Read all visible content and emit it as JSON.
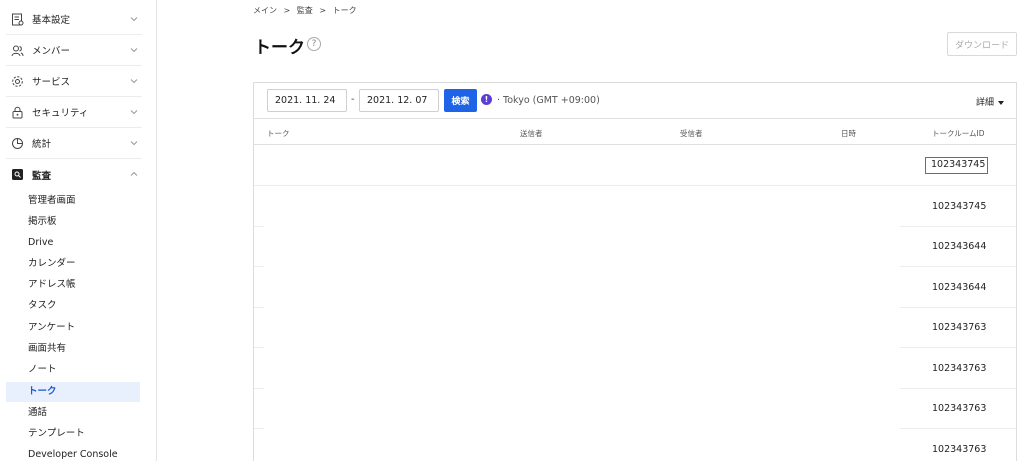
{
  "sidebar": {
    "groups": [
      {
        "label": "基本設定",
        "icon": "settings-doc-icon",
        "expanded": false
      },
      {
        "label": "メンバー",
        "icon": "users-icon",
        "expanded": false
      },
      {
        "label": "サービス",
        "icon": "gear-icon",
        "expanded": false
      },
      {
        "label": "セキュリティ",
        "icon": "lock-icon",
        "expanded": false
      },
      {
        "label": "統計",
        "icon": "pie-chart-icon",
        "expanded": false
      },
      {
        "label": "監査",
        "icon": "audit-icon",
        "expanded": true
      }
    ],
    "audit_items": [
      "管理者画面",
      "掲示板",
      "Drive",
      "カレンダー",
      "アドレス帳",
      "タスク",
      "アンケート",
      "画面共有",
      "ノート",
      "トーク",
      "通話",
      "テンプレート",
      "Developer Console"
    ],
    "active_item": "トーク"
  },
  "breadcrumb": [
    "メイン",
    "監査",
    "トーク"
  ],
  "breadcrumb_sep": ">",
  "page_title": "トーク",
  "help_glyph": "?",
  "download_label": "ダウンロード",
  "filters": {
    "start_date": "2021. 11. 24",
    "end_date": "2021. 12. 07",
    "separator": "-",
    "search_label": "検索",
    "timezone": "· Tokyo (GMT +09:00)",
    "detail_label": "詳細"
  },
  "table": {
    "columns": [
      "トーク",
      "送信者",
      "受信者",
      "日時",
      "トークルームID"
    ],
    "rows": [
      {
        "room_id": "102343745",
        "highlighted": true
      },
      {
        "room_id": "102343745",
        "highlighted": false
      },
      {
        "room_id": "102343644",
        "highlighted": false
      },
      {
        "room_id": "102343644",
        "highlighted": false
      },
      {
        "room_id": "102343763",
        "highlighted": false
      },
      {
        "room_id": "102343763",
        "highlighted": false
      },
      {
        "room_id": "102343763",
        "highlighted": false
      },
      {
        "room_id": "102343763",
        "highlighted": false
      }
    ]
  },
  "colors": {
    "accent": "#1f63e6",
    "highlight_border": "#d9432b",
    "info": "#5a3fd1"
  }
}
